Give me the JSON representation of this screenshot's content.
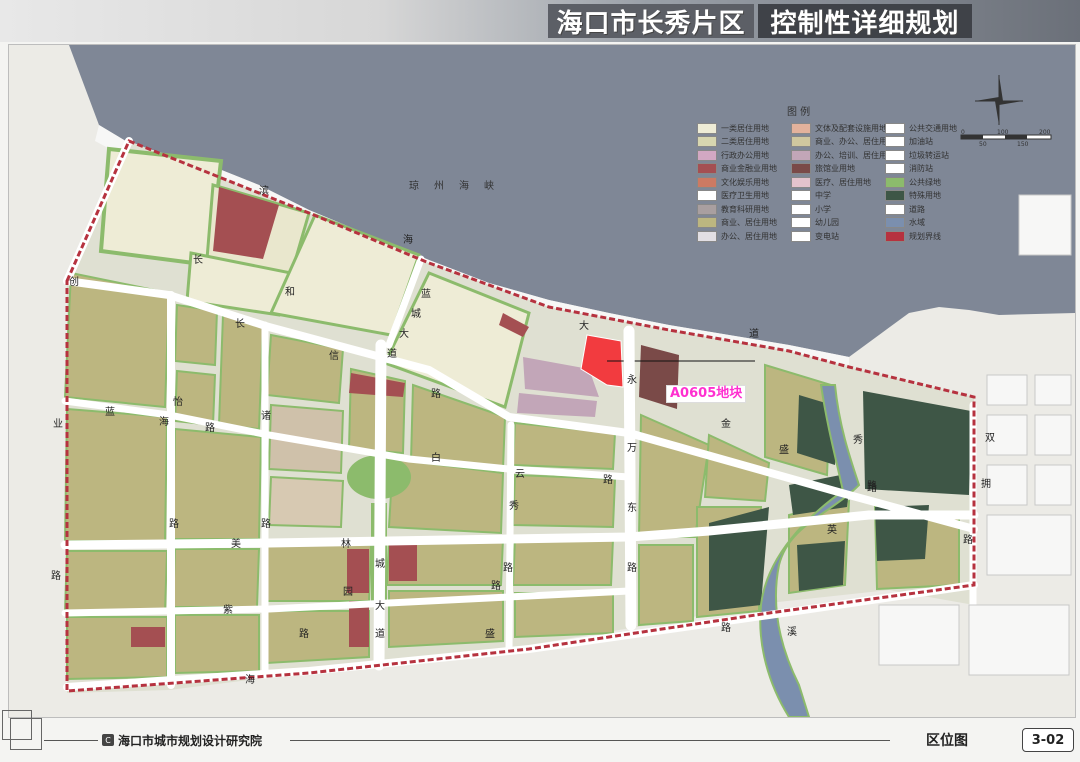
{
  "header": {
    "title_main": "海口市长秀片区",
    "title_sub": "控制性详细规划"
  },
  "map": {
    "sea_name": "琼州海峡",
    "highlight_parcel": "A0605地块",
    "road_labels": [
      {
        "text": "滨",
        "pos": "a"
      },
      {
        "text": "海",
        "pos": "b"
      },
      {
        "text": "大",
        "pos": "c"
      },
      {
        "text": "道",
        "pos": "d"
      },
      {
        "text": "长",
        "pos": "e"
      },
      {
        "text": "和",
        "pos": "f"
      },
      {
        "text": "长",
        "pos": "g"
      },
      {
        "text": "信",
        "pos": "h"
      },
      {
        "text": "路",
        "pos": "i"
      },
      {
        "text": "蓝",
        "pos": "j"
      },
      {
        "text": "城",
        "pos": "k"
      },
      {
        "text": "大",
        "pos": "l"
      },
      {
        "text": "道",
        "pos": "m"
      },
      {
        "text": "创",
        "pos": "n"
      },
      {
        "text": "业",
        "pos": "o"
      },
      {
        "text": "路",
        "pos": "p"
      },
      {
        "text": "蓝",
        "pos": "q"
      },
      {
        "text": "海",
        "pos": "r"
      },
      {
        "text": "路",
        "pos": "s"
      },
      {
        "text": "怡",
        "pos": "t"
      },
      {
        "text": "路",
        "pos": "u"
      },
      {
        "text": "诸",
        "pos": "v"
      },
      {
        "text": "路",
        "pos": "w"
      },
      {
        "text": "美",
        "pos": "x"
      },
      {
        "text": "林",
        "pos": "y"
      },
      {
        "text": "紫",
        "pos": "z"
      },
      {
        "text": "园",
        "pos": "aa"
      },
      {
        "text": "盛",
        "pos": "ab"
      },
      {
        "text": "海",
        "pos": "ac"
      },
      {
        "text": "路",
        "pos": "ad"
      },
      {
        "text": "白",
        "pos": "ae"
      },
      {
        "text": "云",
        "pos": "af"
      },
      {
        "text": "秀",
        "pos": "ag"
      },
      {
        "text": "路",
        "pos": "ah"
      },
      {
        "text": "路",
        "pos": "ai"
      },
      {
        "text": "城",
        "pos": "aj"
      },
      {
        "text": "大",
        "pos": "ak"
      },
      {
        "text": "道",
        "pos": "al"
      },
      {
        "text": "永",
        "pos": "am"
      },
      {
        "text": "万",
        "pos": "an"
      },
      {
        "text": "东",
        "pos": "ao"
      },
      {
        "text": "路",
        "pos": "ap"
      },
      {
        "text": "金",
        "pos": "aq"
      },
      {
        "text": "盛",
        "pos": "ar"
      },
      {
        "text": "路",
        "pos": "as"
      },
      {
        "text": "秀",
        "pos": "at"
      },
      {
        "text": "路",
        "pos": "au"
      },
      {
        "text": "英",
        "pos": "av"
      },
      {
        "text": "溪",
        "pos": "aw"
      },
      {
        "text": "双",
        "pos": "ax"
      },
      {
        "text": "拥",
        "pos": "ay"
      },
      {
        "text": "路",
        "pos": "az"
      },
      {
        "text": "路",
        "pos": "ba"
      },
      {
        "text": "路",
        "pos": "bb"
      }
    ]
  },
  "legend": {
    "title": "图  例",
    "items": [
      {
        "label": "一类居住用地",
        "color": "#eeecd6"
      },
      {
        "label": "二类居住用地",
        "color": "#d7d6b0"
      },
      {
        "label": "行政办公用地",
        "color": "#d2a8c3"
      },
      {
        "label": "商业金融业用地",
        "color": "#a44f52"
      },
      {
        "label": "文化娱乐用地",
        "color": "#cc7a63"
      },
      {
        "label": "医疗卫生用地",
        "color": "#ffffff"
      },
      {
        "label": "教育科研用地",
        "color": "#a99fa0"
      },
      {
        "label": "商业、居住用地",
        "color": "#bcb680"
      },
      {
        "label": "办公、居住用地",
        "color": "#e2dfe4"
      },
      {
        "label": "文体及配套设施用地",
        "color": "#e3b29c"
      },
      {
        "label": "商业、办公、居住用地",
        "color": "#cfc79f"
      },
      {
        "label": "办公、培训、居住用地",
        "color": "#c2a6b8"
      },
      {
        "label": "旅馆业用地",
        "color": "#7a4a48"
      },
      {
        "label": "医疗、居住用地",
        "color": "#e4c3cd"
      },
      {
        "label": "中学",
        "color": "#ffffff"
      },
      {
        "label": "小学",
        "color": "#ffffff"
      },
      {
        "label": "幼儿园",
        "color": "#ffffff"
      },
      {
        "label": "变电站",
        "color": "#ffffff"
      },
      {
        "label": "公共交通用地",
        "color": "#ffffff"
      },
      {
        "label": "加油站",
        "color": "#ffffff"
      },
      {
        "label": "垃圾转运站",
        "color": "#ffffff"
      },
      {
        "label": "消防站",
        "color": "#ffffff"
      },
      {
        "label": "公共绿地",
        "color": "#8cbb6c"
      },
      {
        "label": "特殊用地",
        "color": "#3e5646"
      },
      {
        "label": "道路",
        "color": "#ffffff"
      },
      {
        "label": "水域",
        "color": "#7b8fae"
      },
      {
        "label": "规划界线",
        "color": "#b6323f"
      }
    ]
  },
  "scale": {
    "ticks": [
      "0",
      "50",
      "100",
      "150",
      "200",
      "250"
    ]
  },
  "footer": {
    "org_icon": "C",
    "org_name": "海口市城市规划设计研究院",
    "sheet_title": "区位图",
    "sheet_no": "3-02"
  },
  "colors": {
    "highlight": "#f23b3f",
    "label_magenta": "#ff2fd0",
    "boundary": "#b6323f",
    "sea": "#7f8796"
  }
}
